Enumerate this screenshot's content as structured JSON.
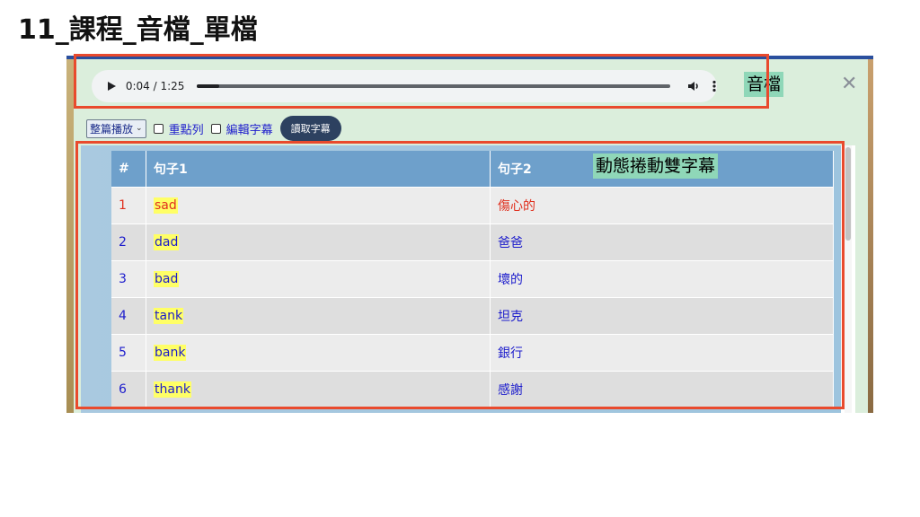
{
  "slide_title": "11_課程_音檔_單檔",
  "audio": {
    "time": "0:04 / 1:25",
    "progress": 0.047
  },
  "callouts": {
    "audio_label": "音檔",
    "subtitle_label": "動態捲動雙字幕"
  },
  "close_label": "✕",
  "toolbar": {
    "mode_select_value": "整篇播放",
    "checkbox_key_rows": "重點列",
    "checkbox_edit_subtitles": "編輯字幕",
    "read_button": "讀取字幕"
  },
  "table": {
    "headers": [
      "#",
      "句子1",
      "句子2"
    ],
    "rows": [
      {
        "num": "1",
        "s1": "sad",
        "s2": "傷心的"
      },
      {
        "num": "2",
        "s1": "dad",
        "s2": "爸爸"
      },
      {
        "num": "3",
        "s1": "bad",
        "s2": "壞的"
      },
      {
        "num": "4",
        "s1": "tank",
        "s2": "坦克"
      },
      {
        "num": "5",
        "s1": "bank",
        "s2": "銀行"
      },
      {
        "num": "6",
        "s1": "thank",
        "s2": "感謝"
      }
    ],
    "active_row": 0
  },
  "colors": {
    "annotation_red": "#e94a2d",
    "callout_bg": "#8fd7b8",
    "header_blue": "#6ea0cb",
    "text_blue": "#1c1ccc",
    "active_red": "#e0301e",
    "highlight_yellow": "#ffff66"
  }
}
